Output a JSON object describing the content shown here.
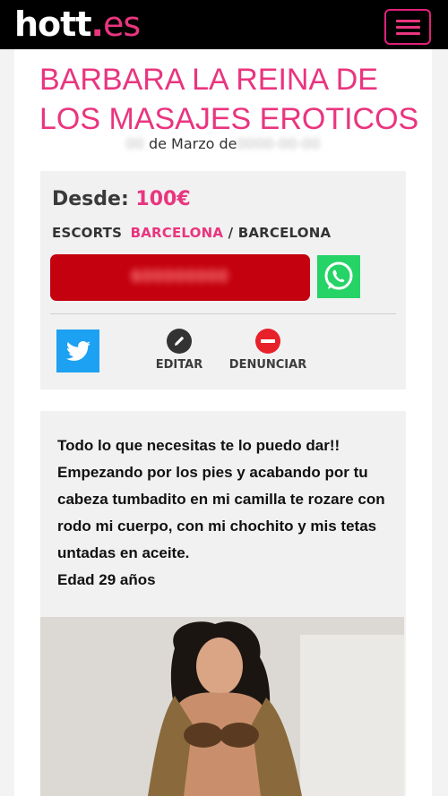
{
  "header": {
    "logo_main": "hott",
    "logo_tld": "es",
    "menu_icon": "hamburger-icon"
  },
  "listing": {
    "title": "BARBARA LA REINA DE LOS MASAJES EROTICOS",
    "date_day": "00",
    "date_text": "de Marzo de",
    "date_year": "0000-00-00",
    "price_label": "Desde:",
    "price_value": "100€",
    "category": "ESCORTS",
    "city_link": "BARCELONA",
    "city_sep": "/ BARCELONA",
    "phone": "600000000",
    "edit_label": "EDITAR",
    "report_label": "DENUNCIAR",
    "description": [
      "Todo lo que necesitas te lo puedo dar!!",
      "Empezando por los pies y acabando por tu cabeza tumbadito en mi camilla te rozare con rodo mi cuerpo, con mi chochito y mis tetas untadas en aceite.",
      "Edad 29 años"
    ]
  },
  "colors": {
    "accent": "#e9357f",
    "phone_bg": "#c4010e",
    "whatsapp": "#25d366",
    "twitter": "#1da1f2"
  },
  "icons": [
    "hamburger-icon",
    "whatsapp-icon",
    "twitter-icon",
    "pencil-icon",
    "no-entry-icon"
  ]
}
